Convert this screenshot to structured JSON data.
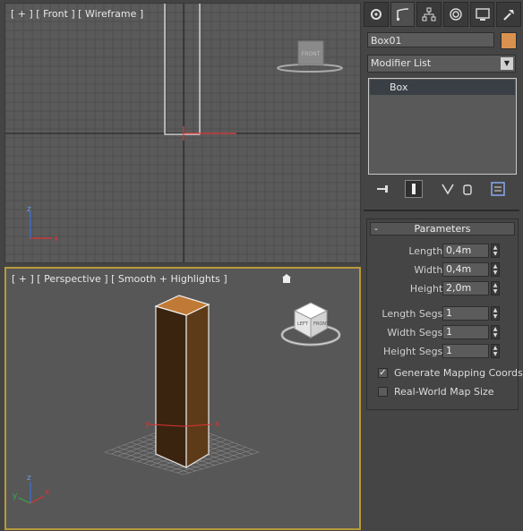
{
  "viewports": {
    "front": {
      "label": "[ + ] [ Front ] [ Wireframe ]",
      "cube_label": "FRONT"
    },
    "perspective": {
      "label": "[ + ] [ Perspective ] [ Smooth + Highlights ]",
      "cube_labels": [
        "FRONT",
        "LEFT"
      ]
    },
    "axis_labels": {
      "x": "x",
      "y": "y",
      "z": "z"
    }
  },
  "command_panel": {
    "tabs": [
      "create-icon",
      "modify-icon",
      "hierarchy-icon",
      "motion-icon",
      "display-icon",
      "utilities-icon"
    ],
    "object_name": "Box01",
    "object_color": "#d9914f",
    "modifier_list": "Modifier List",
    "stack": [
      "Box"
    ],
    "stack_tools": [
      "pin-stack-icon",
      "show-end-result-icon",
      "make-unique-icon",
      "remove-modifier-icon",
      "configure-modifier-sets-icon"
    ],
    "parameters": {
      "title": "Parameters",
      "collapse": "-",
      "length_label": "Length:",
      "length_value": "0,4m",
      "width_label": "Width:",
      "width_value": "0,4m",
      "height_label": "Height:",
      "height_value": "2,0m",
      "length_segs_label": "Length Segs:",
      "length_segs_value": "1",
      "width_segs_label": "Width Segs:",
      "width_segs_value": "1",
      "height_segs_label": "Height Segs:",
      "height_segs_value": "1",
      "gen_mapping_label": "Generate Mapping Coords.",
      "gen_mapping_checked": true,
      "real_world_label": "Real-World Map Size",
      "real_world_checked": false
    }
  }
}
